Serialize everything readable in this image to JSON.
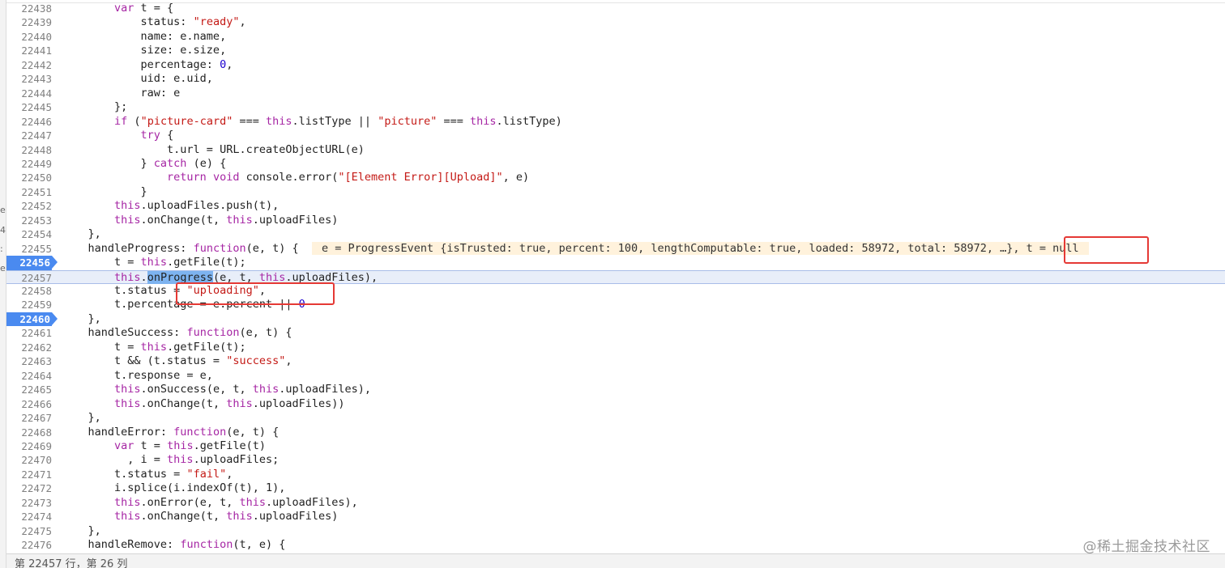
{
  "left_strip": {
    "glyphs": [
      "e",
      "4",
      ":",
      "e"
    ]
  },
  "code_lines": [
    {
      "num": "22438",
      "bp": false,
      "tokens": [
        [
          "",
          "        "
        ],
        [
          "kw",
          "var"
        ],
        [
          "",
          " t = {"
        ]
      ]
    },
    {
      "num": "22439",
      "bp": false,
      "tokens": [
        [
          "",
          "            status: "
        ],
        [
          "str",
          "\"ready\""
        ],
        [
          "",
          ","
        ]
      ]
    },
    {
      "num": "22440",
      "bp": false,
      "tokens": [
        [
          "",
          "            name: e.name,"
        ]
      ]
    },
    {
      "num": "22441",
      "bp": false,
      "tokens": [
        [
          "",
          "            size: e.size,"
        ]
      ]
    },
    {
      "num": "22442",
      "bp": false,
      "tokens": [
        [
          "",
          "            percentage: "
        ],
        [
          "num",
          "0"
        ],
        [
          "",
          ","
        ]
      ]
    },
    {
      "num": "22443",
      "bp": false,
      "tokens": [
        [
          "",
          "            uid: e.uid,"
        ]
      ]
    },
    {
      "num": "22444",
      "bp": false,
      "tokens": [
        [
          "",
          "            raw: e"
        ]
      ]
    },
    {
      "num": "22445",
      "bp": false,
      "tokens": [
        [
          "",
          "        };"
        ]
      ]
    },
    {
      "num": "22446",
      "bp": false,
      "tokens": [
        [
          "",
          "        "
        ],
        [
          "kw",
          "if"
        ],
        [
          "",
          " ("
        ],
        [
          "str",
          "\"picture-card\""
        ],
        [
          "",
          " === "
        ],
        [
          "kw",
          "this"
        ],
        [
          "",
          ".listType || "
        ],
        [
          "str",
          "\"picture\""
        ],
        [
          "",
          " === "
        ],
        [
          "kw",
          "this"
        ],
        [
          "",
          ".listType)"
        ]
      ]
    },
    {
      "num": "22447",
      "bp": false,
      "tokens": [
        [
          "",
          "            "
        ],
        [
          "kw",
          "try"
        ],
        [
          "",
          " {"
        ]
      ]
    },
    {
      "num": "22448",
      "bp": false,
      "tokens": [
        [
          "",
          "                t.url = URL.createObjectURL(e)"
        ]
      ]
    },
    {
      "num": "22449",
      "bp": false,
      "tokens": [
        [
          "",
          "            } "
        ],
        [
          "kw",
          "catch"
        ],
        [
          "",
          " (e) {"
        ]
      ]
    },
    {
      "num": "22450",
      "bp": false,
      "tokens": [
        [
          "",
          "                "
        ],
        [
          "kw",
          "return"
        ],
        [
          "",
          " "
        ],
        [
          "kw",
          "void"
        ],
        [
          "",
          " console.error("
        ],
        [
          "str",
          "\"[Element Error][Upload]\""
        ],
        [
          "",
          ", e)"
        ]
      ]
    },
    {
      "num": "22451",
      "bp": false,
      "tokens": [
        [
          "",
          "            }"
        ]
      ]
    },
    {
      "num": "22452",
      "bp": false,
      "tokens": [
        [
          "",
          "        "
        ],
        [
          "kw",
          "this"
        ],
        [
          "",
          ".uploadFiles.push(t),"
        ]
      ]
    },
    {
      "num": "22453",
      "bp": false,
      "tokens": [
        [
          "",
          "        "
        ],
        [
          "kw",
          "this"
        ],
        [
          "",
          ".onChange(t, "
        ],
        [
          "kw",
          "this"
        ],
        [
          "",
          ".uploadFiles)"
        ]
      ]
    },
    {
      "num": "22454",
      "bp": false,
      "tokens": [
        [
          "",
          "    },"
        ]
      ]
    },
    {
      "num": "22455",
      "bp": false,
      "tokens": [
        [
          "",
          "    handleProgress: "
        ],
        [
          "kw",
          "function"
        ],
        [
          "",
          "(e, t) {  "
        ],
        [
          "inline",
          " e = ProgressEvent {isTrusted: true, percent: 100, lengthComputable: true, loaded: 58972, total: 58972, …}, t = null "
        ]
      ]
    },
    {
      "num": "22456",
      "bp": true,
      "tokens": [
        [
          "",
          "        t = "
        ],
        [
          "kw",
          "this"
        ],
        [
          "",
          ".getFile(t);"
        ]
      ]
    },
    {
      "num": "22457",
      "bp": false,
      "current": true,
      "tokens": [
        [
          "",
          "        "
        ],
        [
          "kw",
          "this"
        ],
        [
          "",
          "."
        ],
        [
          "hl",
          "onProgress"
        ],
        [
          "",
          "(e, t, "
        ],
        [
          "kw",
          "this"
        ],
        [
          "",
          ".uploadFiles),"
        ]
      ]
    },
    {
      "num": "22458",
      "bp": false,
      "tokens": [
        [
          "",
          "        t.status = "
        ],
        [
          "str",
          "\"uploading\""
        ],
        [
          "",
          ","
        ]
      ]
    },
    {
      "num": "22459",
      "bp": false,
      "tokens": [
        [
          "",
          "        t.percentage = e.percent || "
        ],
        [
          "num",
          "0"
        ]
      ]
    },
    {
      "num": "22460",
      "bp": true,
      "tokens": [
        [
          "",
          "    },"
        ]
      ]
    },
    {
      "num": "22461",
      "bp": false,
      "tokens": [
        [
          "",
          "    handleSuccess: "
        ],
        [
          "kw",
          "function"
        ],
        [
          "",
          "(e, t) {"
        ]
      ]
    },
    {
      "num": "22462",
      "bp": false,
      "tokens": [
        [
          "",
          "        t = "
        ],
        [
          "kw",
          "this"
        ],
        [
          "",
          ".getFile(t);"
        ]
      ]
    },
    {
      "num": "22463",
      "bp": false,
      "tokens": [
        [
          "",
          "        t && (t.status = "
        ],
        [
          "str",
          "\"success\""
        ],
        [
          "",
          ","
        ]
      ]
    },
    {
      "num": "22464",
      "bp": false,
      "tokens": [
        [
          "",
          "        t.response = e,"
        ]
      ]
    },
    {
      "num": "22465",
      "bp": false,
      "tokens": [
        [
          "",
          "        "
        ],
        [
          "kw",
          "this"
        ],
        [
          "",
          ".onSuccess(e, t, "
        ],
        [
          "kw",
          "this"
        ],
        [
          "",
          ".uploadFiles),"
        ]
      ]
    },
    {
      "num": "22466",
      "bp": false,
      "tokens": [
        [
          "",
          "        "
        ],
        [
          "kw",
          "this"
        ],
        [
          "",
          ".onChange(t, "
        ],
        [
          "kw",
          "this"
        ],
        [
          "",
          ".uploadFiles))"
        ]
      ]
    },
    {
      "num": "22467",
      "bp": false,
      "tokens": [
        [
          "",
          "    },"
        ]
      ]
    },
    {
      "num": "22468",
      "bp": false,
      "tokens": [
        [
          "",
          "    handleError: "
        ],
        [
          "kw",
          "function"
        ],
        [
          "",
          "(e, t) {"
        ]
      ]
    },
    {
      "num": "22469",
      "bp": false,
      "tokens": [
        [
          "",
          "        "
        ],
        [
          "kw",
          "var"
        ],
        [
          "",
          " t = "
        ],
        [
          "kw",
          "this"
        ],
        [
          "",
          ".getFile(t)"
        ]
      ]
    },
    {
      "num": "22470",
      "bp": false,
      "tokens": [
        [
          "",
          "          , i = "
        ],
        [
          "kw",
          "this"
        ],
        [
          "",
          ".uploadFiles;"
        ]
      ]
    },
    {
      "num": "22471",
      "bp": false,
      "tokens": [
        [
          "",
          "        t.status = "
        ],
        [
          "str",
          "\"fail\""
        ],
        [
          "",
          ","
        ]
      ]
    },
    {
      "num": "22472",
      "bp": false,
      "tokens": [
        [
          "",
          "        i.splice(i.indexOf(t), 1),"
        ]
      ]
    },
    {
      "num": "22473",
      "bp": false,
      "tokens": [
        [
          "",
          "        "
        ],
        [
          "kw",
          "this"
        ],
        [
          "",
          ".onError(e, t, "
        ],
        [
          "kw",
          "this"
        ],
        [
          "",
          ".uploadFiles),"
        ]
      ]
    },
    {
      "num": "22474",
      "bp": false,
      "tokens": [
        [
          "",
          "        "
        ],
        [
          "kw",
          "this"
        ],
        [
          "",
          ".onChange(t, "
        ],
        [
          "kw",
          "this"
        ],
        [
          "",
          ".uploadFiles)"
        ]
      ]
    },
    {
      "num": "22475",
      "bp": false,
      "tokens": [
        [
          "",
          "    },"
        ]
      ]
    },
    {
      "num": "22476",
      "bp": false,
      "tokens": [
        [
          "",
          "    handleRemove: "
        ],
        [
          "kw",
          "function"
        ],
        [
          "",
          "(t, e) {"
        ]
      ]
    }
  ],
  "status_bar": {
    "text": "第 22457 行，第 26 列"
  },
  "watermark": "@稀土掘金技术社区",
  "colors": {
    "keyword": "#a626a4",
    "string": "#c41a16",
    "number": "#1c00cf",
    "breakpoint": "#4a8af0",
    "current_line": "#e8eef9",
    "inline_value_bg": "#fff2dc",
    "annotation_box": "#e53935"
  }
}
